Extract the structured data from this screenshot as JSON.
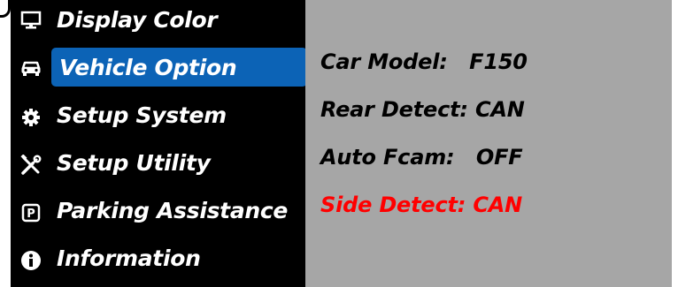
{
  "menu": {
    "items": [
      {
        "label": "Display Color",
        "icon": "monitor-icon",
        "selected": false
      },
      {
        "label": "Vehicle Option",
        "icon": "car-icon",
        "selected": true
      },
      {
        "label": "Setup System",
        "icon": "gear-icon",
        "selected": false
      },
      {
        "label": "Setup Utility",
        "icon": "tools-icon",
        "selected": false
      },
      {
        "label": "Parking Assistance",
        "icon": "parking-icon",
        "selected": false
      },
      {
        "label": "Information",
        "icon": "info-icon",
        "selected": false
      }
    ]
  },
  "detail": {
    "lines": [
      {
        "label": "Car Model:   F150",
        "active": false
      },
      {
        "label": "Rear Detect: CAN",
        "active": false
      },
      {
        "label": "Auto Fcam:   OFF",
        "active": false
      },
      {
        "label": "Side Detect: CAN",
        "active": true
      }
    ]
  },
  "colors": {
    "menu_bg": "#000000",
    "selected_bg": "#0c63b6",
    "detail_bg": "#a6a6a6",
    "active_text": "#ff0000"
  }
}
